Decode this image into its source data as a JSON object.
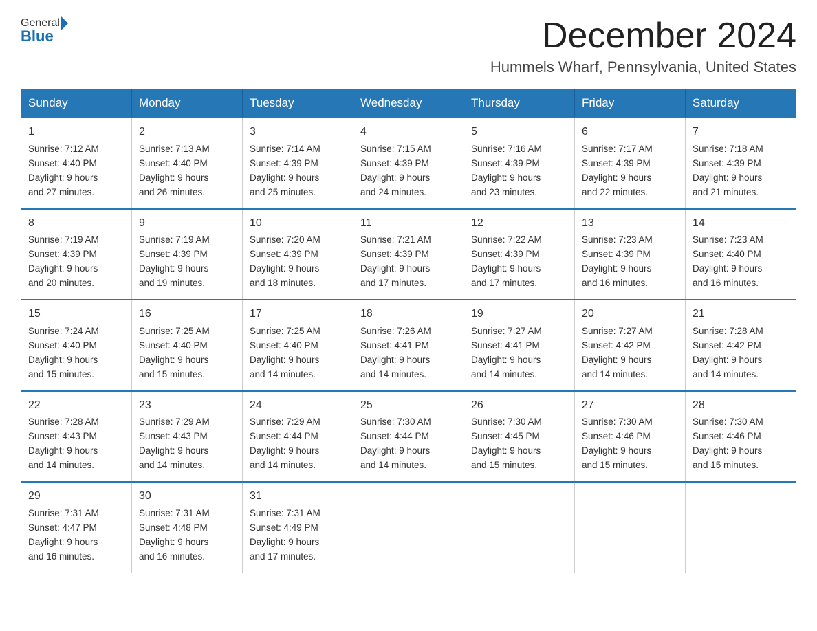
{
  "header": {
    "logo_general": "General",
    "logo_blue": "Blue",
    "month_title": "December 2024",
    "location": "Hummels Wharf, Pennsylvania, United States"
  },
  "days_of_week": [
    "Sunday",
    "Monday",
    "Tuesday",
    "Wednesday",
    "Thursday",
    "Friday",
    "Saturday"
  ],
  "weeks": [
    [
      {
        "day": "1",
        "sunrise": "7:12 AM",
        "sunset": "4:40 PM",
        "daylight": "9 hours and 27 minutes."
      },
      {
        "day": "2",
        "sunrise": "7:13 AM",
        "sunset": "4:40 PM",
        "daylight": "9 hours and 26 minutes."
      },
      {
        "day": "3",
        "sunrise": "7:14 AM",
        "sunset": "4:39 PM",
        "daylight": "9 hours and 25 minutes."
      },
      {
        "day": "4",
        "sunrise": "7:15 AM",
        "sunset": "4:39 PM",
        "daylight": "9 hours and 24 minutes."
      },
      {
        "day": "5",
        "sunrise": "7:16 AM",
        "sunset": "4:39 PM",
        "daylight": "9 hours and 23 minutes."
      },
      {
        "day": "6",
        "sunrise": "7:17 AM",
        "sunset": "4:39 PM",
        "daylight": "9 hours and 22 minutes."
      },
      {
        "day": "7",
        "sunrise": "7:18 AM",
        "sunset": "4:39 PM",
        "daylight": "9 hours and 21 minutes."
      }
    ],
    [
      {
        "day": "8",
        "sunrise": "7:19 AM",
        "sunset": "4:39 PM",
        "daylight": "9 hours and 20 minutes."
      },
      {
        "day": "9",
        "sunrise": "7:19 AM",
        "sunset": "4:39 PM",
        "daylight": "9 hours and 19 minutes."
      },
      {
        "day": "10",
        "sunrise": "7:20 AM",
        "sunset": "4:39 PM",
        "daylight": "9 hours and 18 minutes."
      },
      {
        "day": "11",
        "sunrise": "7:21 AM",
        "sunset": "4:39 PM",
        "daylight": "9 hours and 17 minutes."
      },
      {
        "day": "12",
        "sunrise": "7:22 AM",
        "sunset": "4:39 PM",
        "daylight": "9 hours and 17 minutes."
      },
      {
        "day": "13",
        "sunrise": "7:23 AM",
        "sunset": "4:39 PM",
        "daylight": "9 hours and 16 minutes."
      },
      {
        "day": "14",
        "sunrise": "7:23 AM",
        "sunset": "4:40 PM",
        "daylight": "9 hours and 16 minutes."
      }
    ],
    [
      {
        "day": "15",
        "sunrise": "7:24 AM",
        "sunset": "4:40 PM",
        "daylight": "9 hours and 15 minutes."
      },
      {
        "day": "16",
        "sunrise": "7:25 AM",
        "sunset": "4:40 PM",
        "daylight": "9 hours and 15 minutes."
      },
      {
        "day": "17",
        "sunrise": "7:25 AM",
        "sunset": "4:40 PM",
        "daylight": "9 hours and 14 minutes."
      },
      {
        "day": "18",
        "sunrise": "7:26 AM",
        "sunset": "4:41 PM",
        "daylight": "9 hours and 14 minutes."
      },
      {
        "day": "19",
        "sunrise": "7:27 AM",
        "sunset": "4:41 PM",
        "daylight": "9 hours and 14 minutes."
      },
      {
        "day": "20",
        "sunrise": "7:27 AM",
        "sunset": "4:42 PM",
        "daylight": "9 hours and 14 minutes."
      },
      {
        "day": "21",
        "sunrise": "7:28 AM",
        "sunset": "4:42 PM",
        "daylight": "9 hours and 14 minutes."
      }
    ],
    [
      {
        "day": "22",
        "sunrise": "7:28 AM",
        "sunset": "4:43 PM",
        "daylight": "9 hours and 14 minutes."
      },
      {
        "day": "23",
        "sunrise": "7:29 AM",
        "sunset": "4:43 PM",
        "daylight": "9 hours and 14 minutes."
      },
      {
        "day": "24",
        "sunrise": "7:29 AM",
        "sunset": "4:44 PM",
        "daylight": "9 hours and 14 minutes."
      },
      {
        "day": "25",
        "sunrise": "7:30 AM",
        "sunset": "4:44 PM",
        "daylight": "9 hours and 14 minutes."
      },
      {
        "day": "26",
        "sunrise": "7:30 AM",
        "sunset": "4:45 PM",
        "daylight": "9 hours and 15 minutes."
      },
      {
        "day": "27",
        "sunrise": "7:30 AM",
        "sunset": "4:46 PM",
        "daylight": "9 hours and 15 minutes."
      },
      {
        "day": "28",
        "sunrise": "7:30 AM",
        "sunset": "4:46 PM",
        "daylight": "9 hours and 15 minutes."
      }
    ],
    [
      {
        "day": "29",
        "sunrise": "7:31 AM",
        "sunset": "4:47 PM",
        "daylight": "9 hours and 16 minutes."
      },
      {
        "day": "30",
        "sunrise": "7:31 AM",
        "sunset": "4:48 PM",
        "daylight": "9 hours and 16 minutes."
      },
      {
        "day": "31",
        "sunrise": "7:31 AM",
        "sunset": "4:49 PM",
        "daylight": "9 hours and 17 minutes."
      },
      null,
      null,
      null,
      null
    ]
  ],
  "labels": {
    "sunrise": "Sunrise:",
    "sunset": "Sunset:",
    "daylight": "Daylight:"
  }
}
